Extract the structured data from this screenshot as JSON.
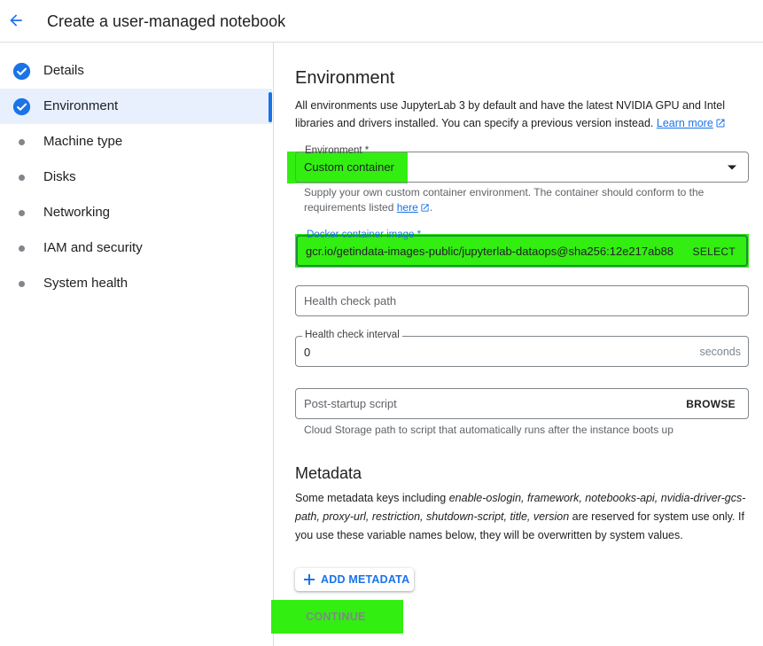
{
  "header": {
    "title": "Create a user-managed notebook"
  },
  "sidebar": {
    "steps": [
      {
        "label": "Details",
        "state": "done"
      },
      {
        "label": "Environment",
        "state": "done"
      },
      {
        "label": "Machine type",
        "state": "pending"
      },
      {
        "label": "Disks",
        "state": "pending"
      },
      {
        "label": "Networking",
        "state": "pending"
      },
      {
        "label": "IAM and security",
        "state": "pending"
      },
      {
        "label": "System health",
        "state": "pending"
      }
    ]
  },
  "main": {
    "heading": "Environment",
    "description": "All environments use JupyterLab 3 by default and have the latest NVIDIA GPU and Intel libraries and drivers installed. You can specify a previous version instead.",
    "learn_more": "Learn more",
    "environment_field": {
      "label": "Environment *",
      "value": "Custom container",
      "hint": "Supply your own custom container environment. The container should conform to the requirements listed",
      "hint_link": "here",
      "hint_end": "."
    },
    "docker_field": {
      "label": "Docker container image *",
      "value": "gcr.io/getindata-images-public/jupyterlab-dataops@sha256:12e217ab88",
      "action": "SELECT"
    },
    "health_check_path": {
      "placeholder": "Health check path"
    },
    "health_check_interval": {
      "label": "Health check interval",
      "value": "0",
      "suffix": "seconds"
    },
    "post_startup": {
      "placeholder": "Post-startup script",
      "action": "BROWSE",
      "hint": "Cloud Storage path to script that automatically runs after the instance boots up"
    },
    "metadata": {
      "heading": "Metadata",
      "text_1": "Some metadata keys including ",
      "reserved_keys": "enable-oslogin, framework, notebooks-api, nvidia-driver-gcs-path, proxy-url, restriction, shutdown-script, title, version",
      "text_2": " are reserved for system use only. If you use these variable names below, they will be overwritten by system values.",
      "add_button": "ADD METADATA"
    },
    "continue_button": "CONTINUE"
  },
  "colors": {
    "accent": "#1a73e8",
    "highlight": "#33ee11",
    "active_step_bg": "#e8f0fe",
    "text": "#202124",
    "muted": "#5f6368"
  }
}
